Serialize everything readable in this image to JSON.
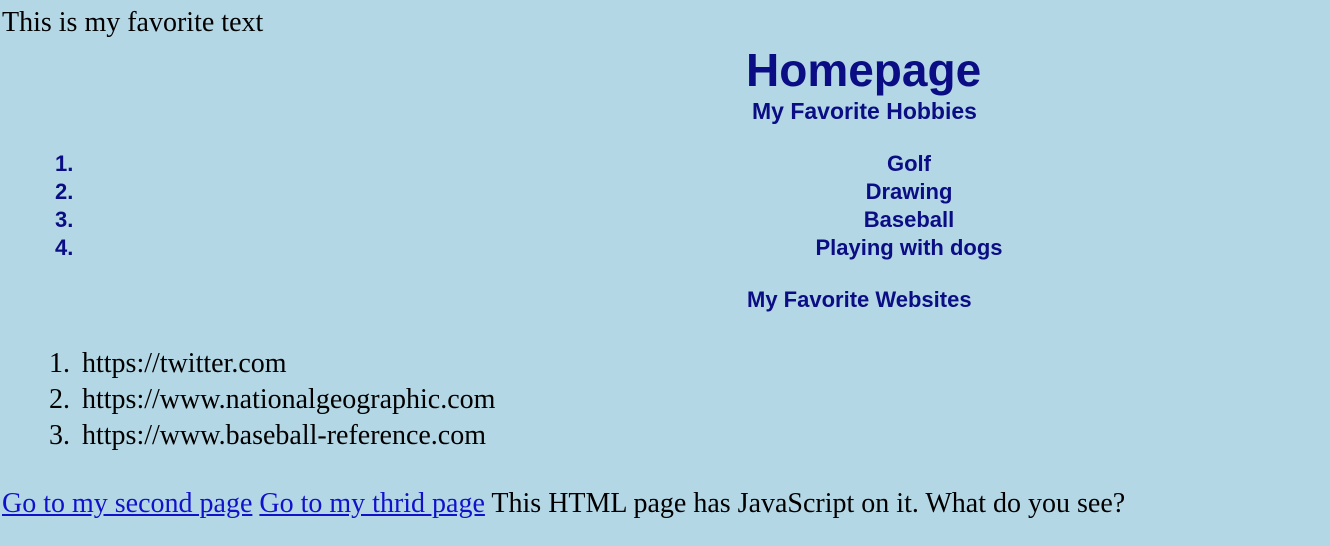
{
  "intro": {
    "text": "This is my favorite text"
  },
  "header": {
    "title": "Homepage"
  },
  "hobbies": {
    "heading": "My Favorite Hobbies",
    "items": [
      {
        "number": "1.",
        "label": "Golf"
      },
      {
        "number": "2.",
        "label": "Drawing"
      },
      {
        "number": "3.",
        "label": "Baseball"
      },
      {
        "number": "4.",
        "label": "Playing with dogs"
      }
    ]
  },
  "websites": {
    "heading": "My Favorite Websites",
    "items": [
      {
        "number": "1.",
        "url": "https://twitter.com"
      },
      {
        "number": "2.",
        "url": "https://www.nationalgeographic.com"
      },
      {
        "number": "3.",
        "url": "https://www.baseball-reference.com"
      }
    ]
  },
  "footer": {
    "link_second": "Go to my second page",
    "link_third": "Go to my thrid page",
    "message": "This HTML page has JavaScript on it. What do you see?"
  },
  "colors": {
    "background": "#b4d7e5",
    "heading": "#0b0d84",
    "link": "#1111cc",
    "text": "#000000"
  }
}
